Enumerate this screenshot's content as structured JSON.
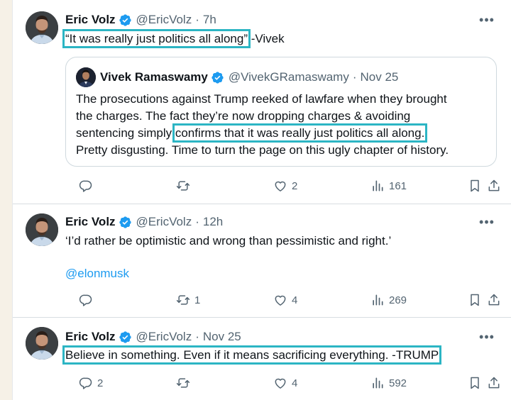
{
  "tweets": [
    {
      "author": {
        "name": "Eric Volz",
        "handle": "@EricVolz"
      },
      "time": "7h",
      "text_highlight": "“It was really just politics all along”",
      "text_rest": " -Vivek",
      "quote": {
        "author": {
          "name": "Vivek Ramaswamy",
          "handle": "@VivekGRamaswamy"
        },
        "time": "Nov 25",
        "line1": "The prosecutions against Trump reeked of lawfare when they brought",
        "line2": "the charges. The fact they’re now dropping charges & avoiding",
        "line3_pre": "sentencing simply ",
        "line3_highlight": "confirms that it was really just politics all along.",
        "line4": "Pretty disgusting. Time to turn the page on this ugly chapter of history."
      },
      "actions": {
        "replies": "",
        "reposts": "",
        "likes": "2",
        "views": "161"
      }
    },
    {
      "author": {
        "name": "Eric Volz",
        "handle": "@EricVolz"
      },
      "time": "12h",
      "text": "‘I’d rather be optimistic and wrong than pessimistic and right.’",
      "mention": "@elonmusk",
      "actions": {
        "replies": "",
        "reposts": "1",
        "likes": "4",
        "views": "269"
      }
    },
    {
      "author": {
        "name": "Eric Volz",
        "handle": "@EricVolz"
      },
      "time": "Nov 25",
      "text_highlight": "Believe in something. Even if it means sacrificing everything. -TRUMP",
      "actions": {
        "replies": "2",
        "reposts": "",
        "likes": "4",
        "views": "592"
      }
    }
  ],
  "separator": "·",
  "more_glyph": "•••",
  "colors": {
    "verified": "#1d9bf0",
    "highlight_box": "#2cb5c4",
    "link": "#1d9bf0",
    "muted": "#536471"
  },
  "icons": [
    "reply-icon",
    "repost-icon",
    "like-icon",
    "views-icon",
    "bookmark-icon",
    "share-icon",
    "verified-badge-icon",
    "more-icon"
  ]
}
